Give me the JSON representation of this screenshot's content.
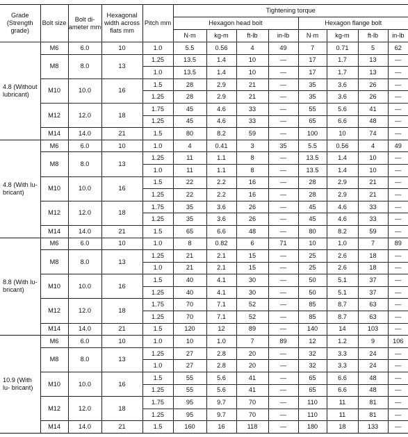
{
  "headers": {
    "grade": "Grade (Strength grade)",
    "bolt_size": "Bolt size",
    "bolt_diameter": "Bolt di- ameter mm",
    "hex_width": "Hexagonal width across flats mm",
    "pitch": "Pitch mm",
    "tightening_torque": "Tightening torque",
    "hex_head_bolt": "Hexagon head bolt",
    "hex_flange_bolt": "Hexagon flange bolt",
    "units": [
      "N·m",
      "kg-m",
      "ft-lb",
      "in-lb",
      "N·m",
      "kg-m",
      "ft-lb",
      "in-lb"
    ]
  },
  "groups": [
    {
      "grade": "4.8 (Without lubricant)",
      "sizes": [
        {
          "size": "M6",
          "diameter": "6.0",
          "width": "10",
          "rows": [
            [
              "1.0",
              "5.5",
              "0.56",
              "4",
              "49",
              "7",
              "0.71",
              "5",
              "62"
            ]
          ]
        },
        {
          "size": "M8",
          "diameter": "8.0",
          "width": "13",
          "rows": [
            [
              "1.25",
              "13.5",
              "1.4",
              "10",
              "—",
              "17",
              "1.7",
              "13",
              "—"
            ],
            [
              "1.0",
              "13.5",
              "1.4",
              "10",
              "—",
              "17",
              "1.7",
              "13",
              "—"
            ]
          ]
        },
        {
          "size": "M10",
          "diameter": "10.0",
          "width": "16",
          "rows": [
            [
              "1.5",
              "28",
              "2.9",
              "21",
              "—",
              "35",
              "3.6",
              "26",
              "—"
            ],
            [
              "1.25",
              "28",
              "2.9",
              "21",
              "—",
              "35",
              "3.6",
              "26",
              "—"
            ]
          ]
        },
        {
          "size": "M12",
          "diameter": "12.0",
          "width": "18",
          "rows": [
            [
              "1.75",
              "45",
              "4.6",
              "33",
              "—",
              "55",
              "5.6",
              "41",
              "—"
            ],
            [
              "1.25",
              "45",
              "4.6",
              "33",
              "—",
              "65",
              "6.6",
              "48",
              "—"
            ]
          ]
        },
        {
          "size": "M14",
          "diameter": "14.0",
          "width": "21",
          "rows": [
            [
              "1.5",
              "80",
              "8.2",
              "59",
              "—",
              "100",
              "10",
              "74",
              "—"
            ]
          ]
        }
      ]
    },
    {
      "grade": "4.8 (With lu- bricant)",
      "sizes": [
        {
          "size": "M6",
          "diameter": "6.0",
          "width": "10",
          "rows": [
            [
              "1.0",
              "4",
              "0.41",
              "3",
              "35",
              "5.5",
              "0.56",
              "4",
              "49"
            ]
          ]
        },
        {
          "size": "M8",
          "diameter": "8.0",
          "width": "13",
          "rows": [
            [
              "1.25",
              "11",
              "1.1",
              "8",
              "—",
              "13.5",
              "1.4",
              "10",
              "—"
            ],
            [
              "1.0",
              "11",
              "1.1",
              "8",
              "—",
              "13.5",
              "1.4",
              "10",
              "—"
            ]
          ]
        },
        {
          "size": "M10",
          "diameter": "10.0",
          "width": "16",
          "rows": [
            [
              "1.5",
              "22",
              "2.2",
              "16",
              "—",
              "28",
              "2.9",
              "21",
              "—"
            ],
            [
              "1.25",
              "22",
              "2.2",
              "16",
              "—",
              "28",
              "2.9",
              "21",
              "—"
            ]
          ]
        },
        {
          "size": "M12",
          "diameter": "12.0",
          "width": "18",
          "rows": [
            [
              "1.75",
              "35",
              "3.6",
              "26",
              "—",
              "45",
              "4.6",
              "33",
              "—"
            ],
            [
              "1.25",
              "35",
              "3.6",
              "26",
              "—",
              "45",
              "4.6",
              "33",
              "—"
            ]
          ]
        },
        {
          "size": "M14",
          "diameter": "14.0",
          "width": "21",
          "rows": [
            [
              "1.5",
              "65",
              "6.6",
              "48",
              "—",
              "80",
              "8.2",
              "59",
              "—"
            ]
          ]
        }
      ]
    },
    {
      "grade": "8.8 (With lu- bricant)",
      "sizes": [
        {
          "size": "M6",
          "diameter": "6.0",
          "width": "10",
          "rows": [
            [
              "1.0",
              "8",
              "0.82",
              "6",
              "71",
              "10",
              "1.0",
              "7",
              "89"
            ]
          ]
        },
        {
          "size": "M8",
          "diameter": "8.0",
          "width": "13",
          "rows": [
            [
              "1.25",
              "21",
              "2.1",
              "15",
              "—",
              "25",
              "2.6",
              "18",
              "—"
            ],
            [
              "1.0",
              "21",
              "2.1",
              "15",
              "—",
              "25",
              "2.6",
              "18",
              "—"
            ]
          ]
        },
        {
          "size": "M10",
          "diameter": "10.0",
          "width": "16",
          "rows": [
            [
              "1.5",
              "40",
              "4.1",
              "30",
              "—",
              "50",
              "5.1",
              "37",
              "—"
            ],
            [
              "1.25",
              "40",
              "4.1",
              "30",
              "—",
              "50",
              "5.1",
              "37",
              "—"
            ]
          ]
        },
        {
          "size": "M12",
          "diameter": "12.0",
          "width": "18",
          "rows": [
            [
              "1.75",
              "70",
              "7.1",
              "52",
              "—",
              "85",
              "8.7",
              "63",
              "—"
            ],
            [
              "1.25",
              "70",
              "7.1",
              "52",
              "—",
              "85",
              "8.7",
              "63",
              "—"
            ]
          ]
        },
        {
          "size": "M14",
          "diameter": "14.0",
          "width": "21",
          "rows": [
            [
              "1.5",
              "120",
              "12",
              "89",
              "—",
              "140",
              "14",
              "103",
              "—"
            ]
          ]
        }
      ]
    },
    {
      "grade": "10.9 (With lu- bricant)",
      "sizes": [
        {
          "size": "M6",
          "diameter": "6.0",
          "width": "10",
          "rows": [
            [
              "1.0",
              "10",
              "1.0",
              "7",
              "89",
              "12",
              "1.2",
              "9",
              "106"
            ]
          ]
        },
        {
          "size": "M8",
          "diameter": "8.0",
          "width": "13",
          "rows": [
            [
              "1.25",
              "27",
              "2.8",
              "20",
              "—",
              "32",
              "3.3",
              "24",
              "—"
            ],
            [
              "1.0",
              "27",
              "2.8",
              "20",
              "—",
              "32",
              "3.3",
              "24",
              "—"
            ]
          ]
        },
        {
          "size": "M10",
          "diameter": "10.0",
          "width": "16",
          "rows": [
            [
              "1.5",
              "55",
              "5.6",
              "41",
              "—",
              "65",
              "6.6",
              "48",
              "—"
            ],
            [
              "1.25",
              "55",
              "5.6",
              "41",
              "—",
              "65",
              "6.6",
              "48",
              "—"
            ]
          ]
        },
        {
          "size": "M12",
          "diameter": "12.0",
          "width": "18",
          "rows": [
            [
              "1.75",
              "95",
              "9.7",
              "70",
              "—",
              "110",
              "11",
              "81",
              "—"
            ],
            [
              "1.25",
              "95",
              "9.7",
              "70",
              "—",
              "110",
              "11",
              "81",
              "—"
            ]
          ]
        },
        {
          "size": "M14",
          "diameter": "14.0",
          "width": "21",
          "rows": [
            [
              "1.5",
              "160",
              "16",
              "118",
              "—",
              "180",
              "18",
              "133",
              "—"
            ]
          ]
        }
      ]
    }
  ]
}
